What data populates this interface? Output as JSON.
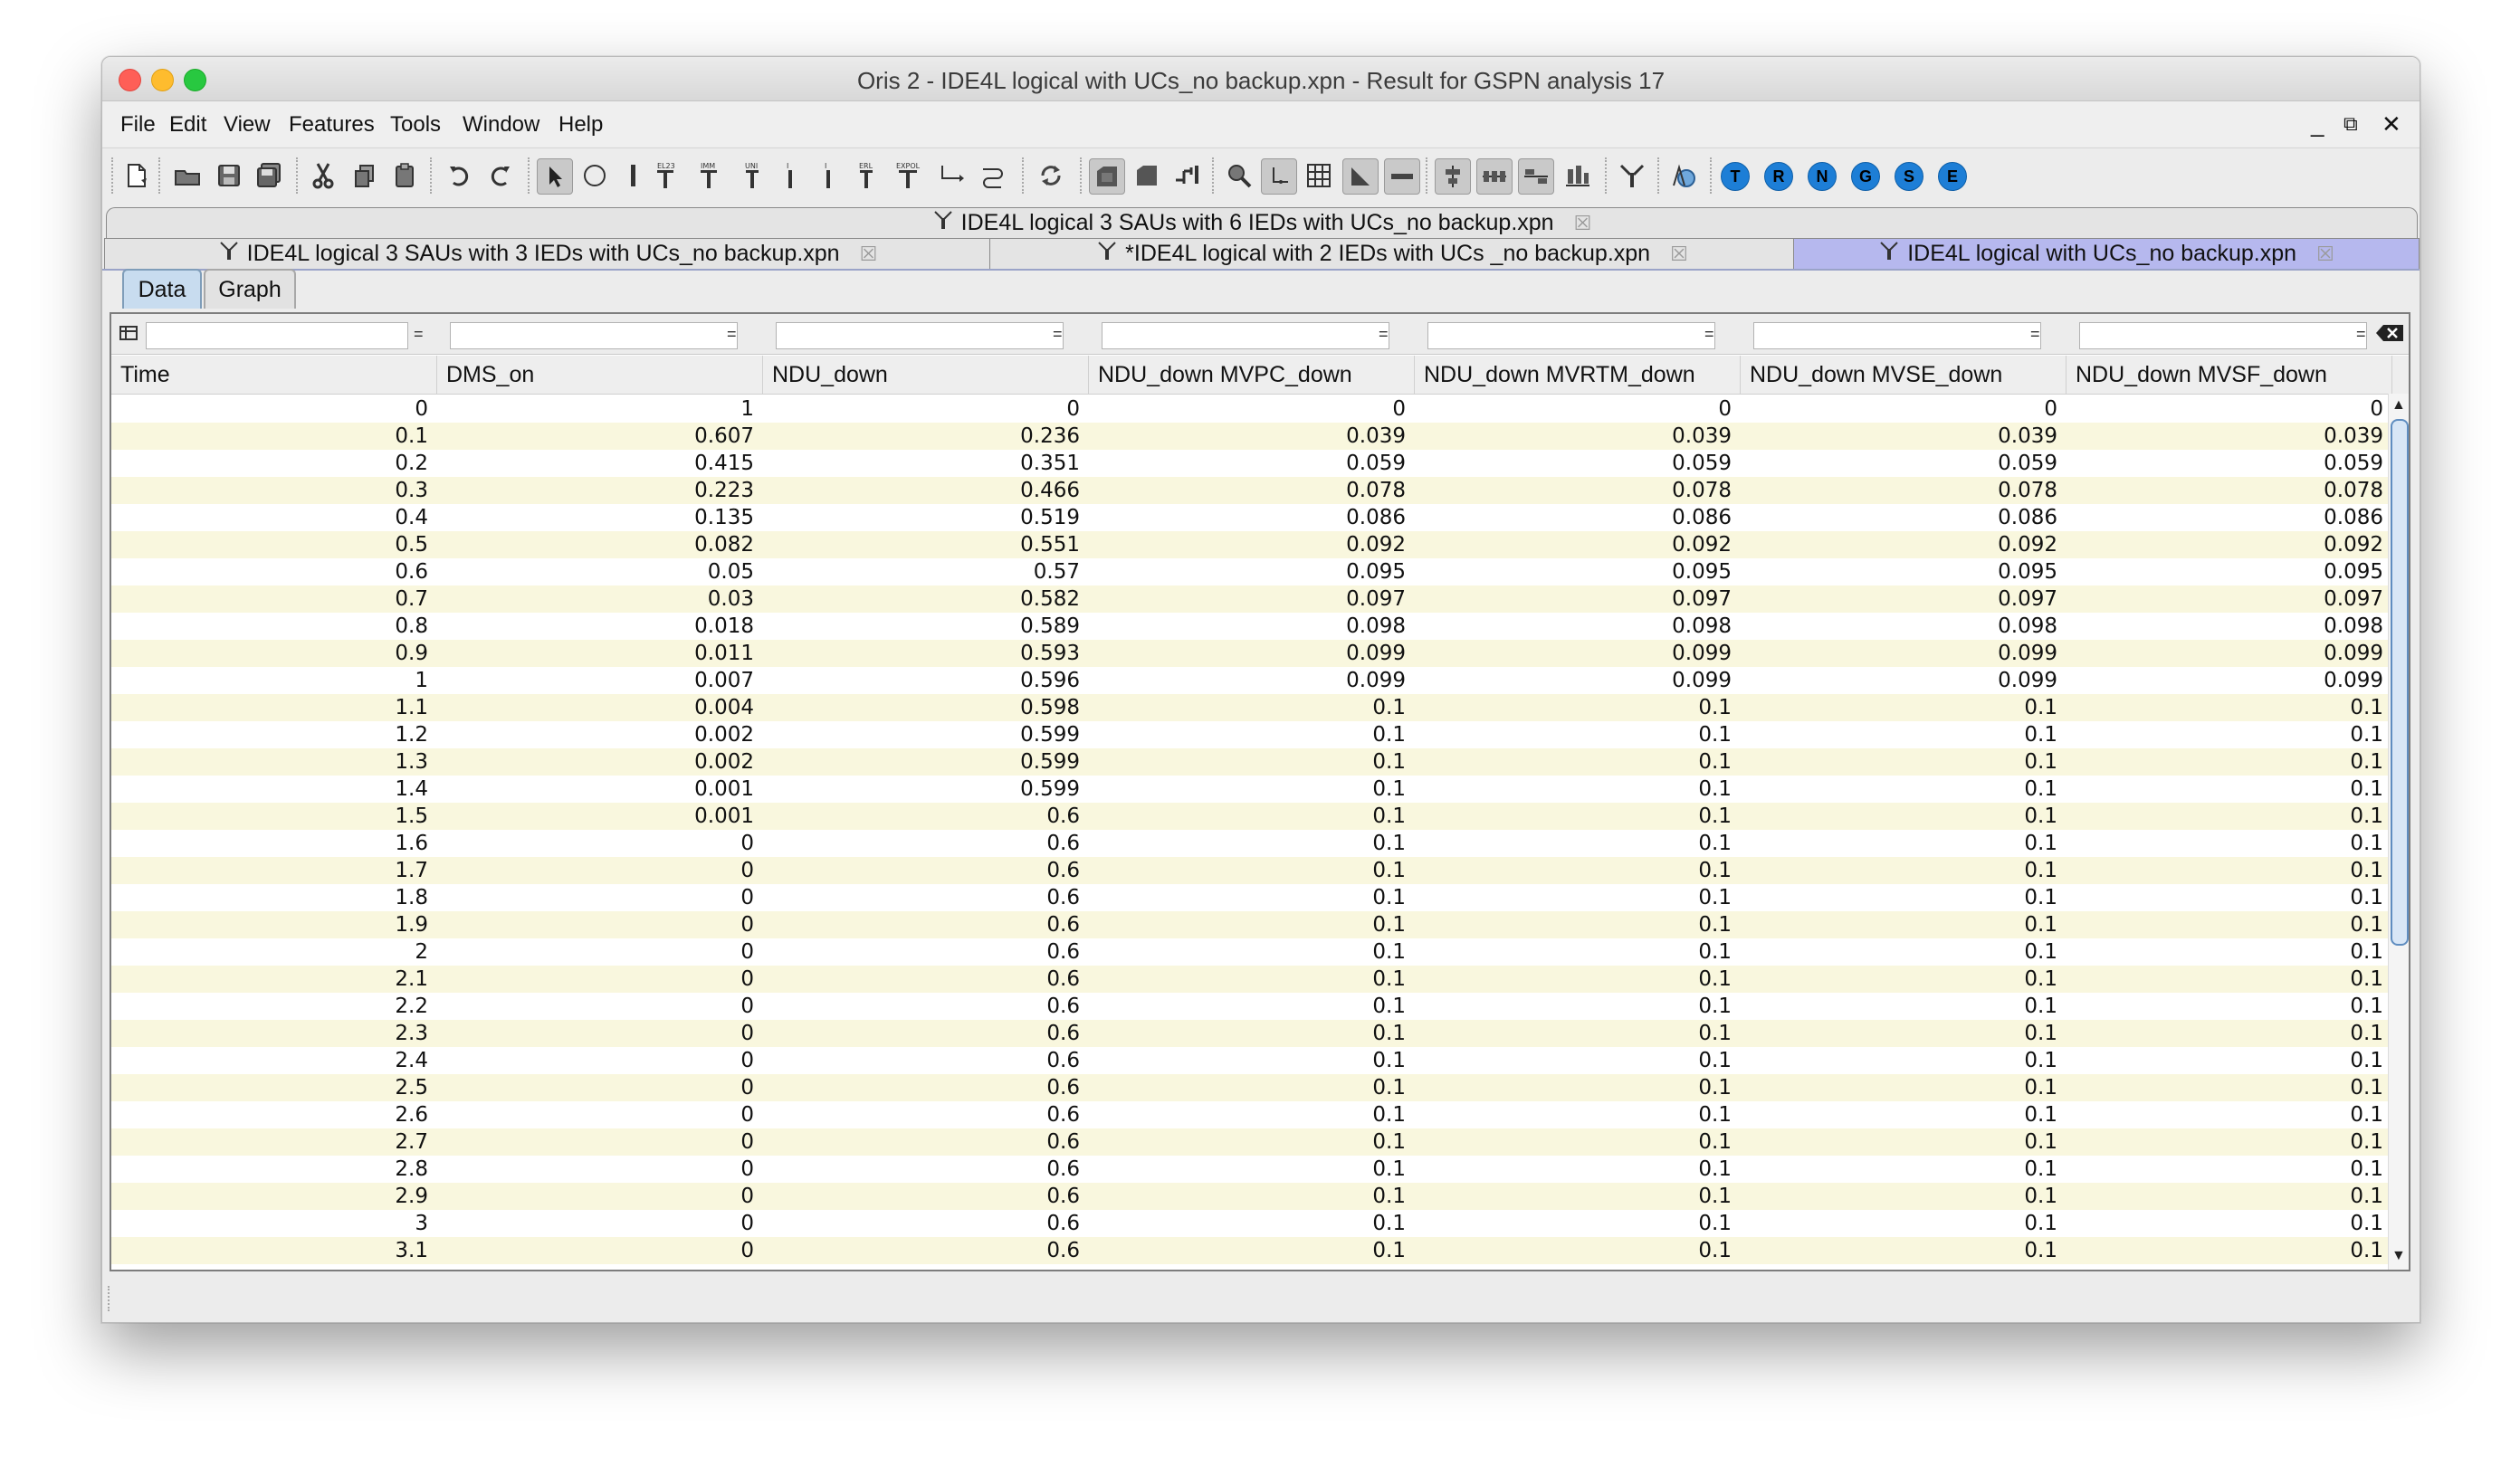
{
  "window": {
    "title": "Oris 2 - IDE4L logical with UCs_no backup.xpn - Result for GSPN analysis 17"
  },
  "menu": [
    "File",
    "Edit",
    "View",
    "Features",
    "Tools",
    "Window",
    "Help"
  ],
  "window_controls": {
    "minimize": "_",
    "restore": "⧉",
    "close": "✕"
  },
  "toolbar": {
    "circle_buttons": [
      "T",
      "R",
      "N",
      "G",
      "S",
      "E"
    ]
  },
  "doc_tabs": {
    "top": {
      "label": "IDE4L logical 3 SAUs with 6 IEDs with UCs_no backup.xpn",
      "close": "☒"
    },
    "row": [
      {
        "label": "IDE4L logical 3 SAUs with 3 IEDs with UCs_no backup.xpn",
        "close": "☒"
      },
      {
        "label": "*IDE4L logical with 2 IEDs with UCs _no backup.xpn",
        "close": "☒"
      },
      {
        "label": "IDE4L logical with UCs_no backup.xpn",
        "close": "☒",
        "active": true
      }
    ]
  },
  "subtabs": {
    "data": "Data",
    "graph": "Graph"
  },
  "table": {
    "filter_button_label": "=",
    "columns": [
      "Time",
      "DMS_on",
      "NDU_down",
      "NDU_down MVPC_down",
      "NDU_down MVRTM_down",
      "NDU_down MVSE_down",
      "NDU_down MVSF_down"
    ],
    "rows": [
      [
        "0",
        "1",
        "0",
        "0",
        "0",
        "0",
        "0"
      ],
      [
        "0.1",
        "0.607",
        "0.236",
        "0.039",
        "0.039",
        "0.039",
        "0.039"
      ],
      [
        "0.2",
        "0.415",
        "0.351",
        "0.059",
        "0.059",
        "0.059",
        "0.059"
      ],
      [
        "0.3",
        "0.223",
        "0.466",
        "0.078",
        "0.078",
        "0.078",
        "0.078"
      ],
      [
        "0.4",
        "0.135",
        "0.519",
        "0.086",
        "0.086",
        "0.086",
        "0.086"
      ],
      [
        "0.5",
        "0.082",
        "0.551",
        "0.092",
        "0.092",
        "0.092",
        "0.092"
      ],
      [
        "0.6",
        "0.05",
        "0.57",
        "0.095",
        "0.095",
        "0.095",
        "0.095"
      ],
      [
        "0.7",
        "0.03",
        "0.582",
        "0.097",
        "0.097",
        "0.097",
        "0.097"
      ],
      [
        "0.8",
        "0.018",
        "0.589",
        "0.098",
        "0.098",
        "0.098",
        "0.098"
      ],
      [
        "0.9",
        "0.011",
        "0.593",
        "0.099",
        "0.099",
        "0.099",
        "0.099"
      ],
      [
        "1",
        "0.007",
        "0.596",
        "0.099",
        "0.099",
        "0.099",
        "0.099"
      ],
      [
        "1.1",
        "0.004",
        "0.598",
        "0.1",
        "0.1",
        "0.1",
        "0.1"
      ],
      [
        "1.2",
        "0.002",
        "0.599",
        "0.1",
        "0.1",
        "0.1",
        "0.1"
      ],
      [
        "1.3",
        "0.002",
        "0.599",
        "0.1",
        "0.1",
        "0.1",
        "0.1"
      ],
      [
        "1.4",
        "0.001",
        "0.599",
        "0.1",
        "0.1",
        "0.1",
        "0.1"
      ],
      [
        "1.5",
        "0.001",
        "0.6",
        "0.1",
        "0.1",
        "0.1",
        "0.1"
      ],
      [
        "1.6",
        "0",
        "0.6",
        "0.1",
        "0.1",
        "0.1",
        "0.1"
      ],
      [
        "1.7",
        "0",
        "0.6",
        "0.1",
        "0.1",
        "0.1",
        "0.1"
      ],
      [
        "1.8",
        "0",
        "0.6",
        "0.1",
        "0.1",
        "0.1",
        "0.1"
      ],
      [
        "1.9",
        "0",
        "0.6",
        "0.1",
        "0.1",
        "0.1",
        "0.1"
      ],
      [
        "2",
        "0",
        "0.6",
        "0.1",
        "0.1",
        "0.1",
        "0.1"
      ],
      [
        "2.1",
        "0",
        "0.6",
        "0.1",
        "0.1",
        "0.1",
        "0.1"
      ],
      [
        "2.2",
        "0",
        "0.6",
        "0.1",
        "0.1",
        "0.1",
        "0.1"
      ],
      [
        "2.3",
        "0",
        "0.6",
        "0.1",
        "0.1",
        "0.1",
        "0.1"
      ],
      [
        "2.4",
        "0",
        "0.6",
        "0.1",
        "0.1",
        "0.1",
        "0.1"
      ],
      [
        "2.5",
        "0",
        "0.6",
        "0.1",
        "0.1",
        "0.1",
        "0.1"
      ],
      [
        "2.6",
        "0",
        "0.6",
        "0.1",
        "0.1",
        "0.1",
        "0.1"
      ],
      [
        "2.7",
        "0",
        "0.6",
        "0.1",
        "0.1",
        "0.1",
        "0.1"
      ],
      [
        "2.8",
        "0",
        "0.6",
        "0.1",
        "0.1",
        "0.1",
        "0.1"
      ],
      [
        "2.9",
        "0",
        "0.6",
        "0.1",
        "0.1",
        "0.1",
        "0.1"
      ],
      [
        "3",
        "0",
        "0.6",
        "0.1",
        "0.1",
        "0.1",
        "0.1"
      ],
      [
        "3.1",
        "0",
        "0.6",
        "0.1",
        "0.1",
        "0.1",
        "0.1"
      ]
    ]
  },
  "colors": {
    "active_tab": "#b6b8ee",
    "row_stripe": "#f9f7de",
    "circle_button": "#1d7ed6"
  }
}
